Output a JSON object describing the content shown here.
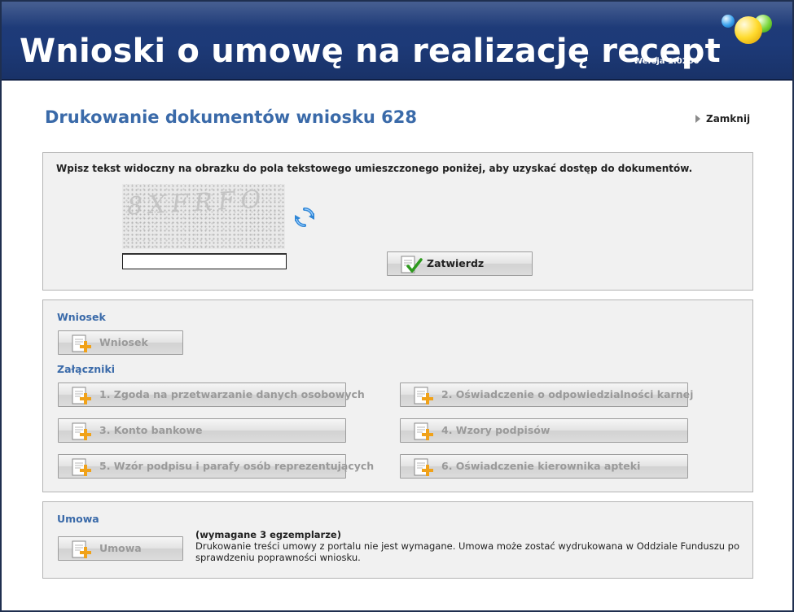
{
  "header": {
    "app_title": "Wnioski o umowę na realizację recept",
    "version": "Wersja 1.0266"
  },
  "page": {
    "title": "Drukowanie dokumentów wniosku 628",
    "close_label": "Zamknij"
  },
  "captcha": {
    "instruction": "Wpisz tekst widoczny na obrazku do pola tekstowego umieszczonego poniżej, aby uzyskać dostęp do dokumentów.",
    "image_text": "8XFRFO",
    "input_value": "",
    "submit_label": "Zatwierdz"
  },
  "wniosek_section": {
    "label": "Wniosek",
    "button_label": "Wniosek"
  },
  "attachments": {
    "label": "Załączniki",
    "items": [
      "1. Zgoda na przetwarzanie danych osobowych",
      "2. Oświadczenie o odpowiedzialności karnej",
      "3. Konto bankowe",
      "4. Wzory podpisów",
      "5. Wzór podpisu i parafy osób reprezentujących",
      "6. Oświadczenie kierownika apteki"
    ]
  },
  "umowa_section": {
    "label": "Umowa",
    "button_label": "Umowa",
    "required_note": "(wymagane 3 egzemplarze)",
    "description": "Drukowanie treści umowy z portalu nie jest wymagane. Umowa może zostać wydrukowana w Oddziale Funduszu po sprawdzeniu poprawności wniosku."
  },
  "icons": {
    "document_add": "document-add-icon",
    "document_check": "document-check-icon",
    "refresh": "refresh-icon",
    "close_arrow": "arrow-right-icon"
  },
  "colors": {
    "header_bg": "#1d3a78",
    "title_blue": "#3a6aa9",
    "panel_bg": "#f1f1f1",
    "disabled_text": "#9a9a9a"
  }
}
